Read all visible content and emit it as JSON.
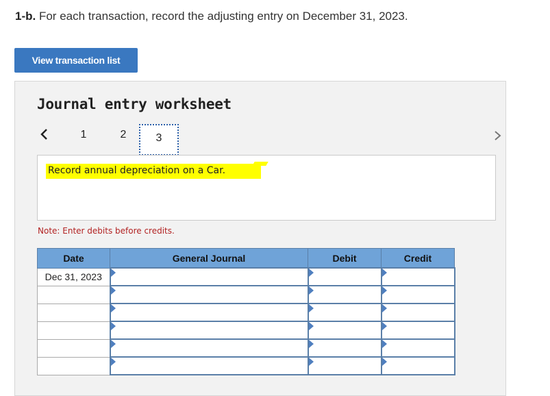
{
  "instruction": {
    "label": "1-b.",
    "text": "For each transaction, record the adjusting entry on December 31, 2023."
  },
  "view_button": {
    "label": "View transaction list"
  },
  "worksheet": {
    "title": "Journal entry worksheet",
    "pager": {
      "pages": [
        "1",
        "2",
        "3"
      ],
      "current": "3"
    },
    "description": "Record annual depreciation on a Car.",
    "note": "Note: Enter debits before credits.",
    "table": {
      "headers": {
        "date": "Date",
        "general_journal": "General Journal",
        "debit": "Debit",
        "credit": "Credit"
      },
      "rows": [
        {
          "date": "Dec 31, 2023",
          "account": "",
          "debit": "",
          "credit": ""
        },
        {
          "date": "",
          "account": "",
          "debit": "",
          "credit": ""
        },
        {
          "date": "",
          "account": "",
          "debit": "",
          "credit": ""
        },
        {
          "date": "",
          "account": "",
          "debit": "",
          "credit": ""
        },
        {
          "date": "",
          "account": "",
          "debit": "",
          "credit": ""
        },
        {
          "date": "",
          "account": "",
          "debit": "",
          "credit": ""
        }
      ]
    }
  },
  "colors": {
    "accent": "#3a78c0",
    "header_blue": "#6fa3d8",
    "highlight": "#ffff00",
    "note_red": "#b22222"
  }
}
